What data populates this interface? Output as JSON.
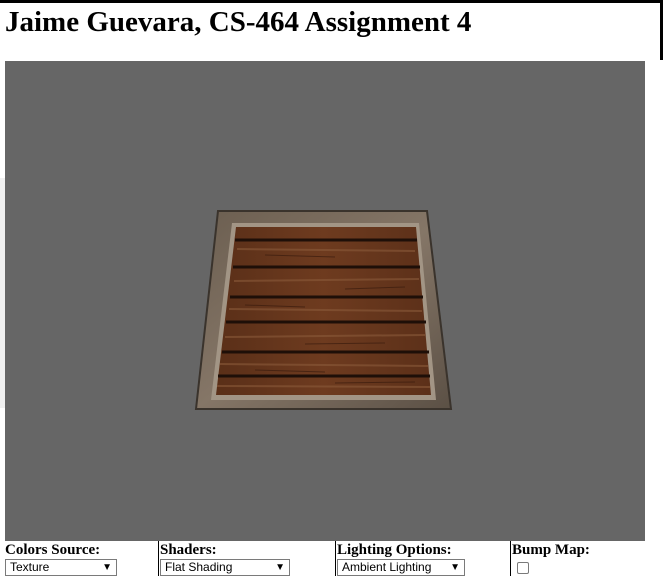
{
  "page": {
    "title": "Jaime Guevara, CS-464 Assignment 4"
  },
  "canvas": {
    "background": "#666666",
    "object": "wooden-crate-texture"
  },
  "controls": {
    "colors_source": {
      "label": "Colors Source:",
      "selected": "Texture"
    },
    "shaders": {
      "label": "Shaders:",
      "selected": "Flat Shading"
    },
    "lighting": {
      "label": "Lighting Options:",
      "selected": "Ambient Lighting"
    },
    "bump_map": {
      "label": "Bump Map:",
      "checked": false
    }
  }
}
